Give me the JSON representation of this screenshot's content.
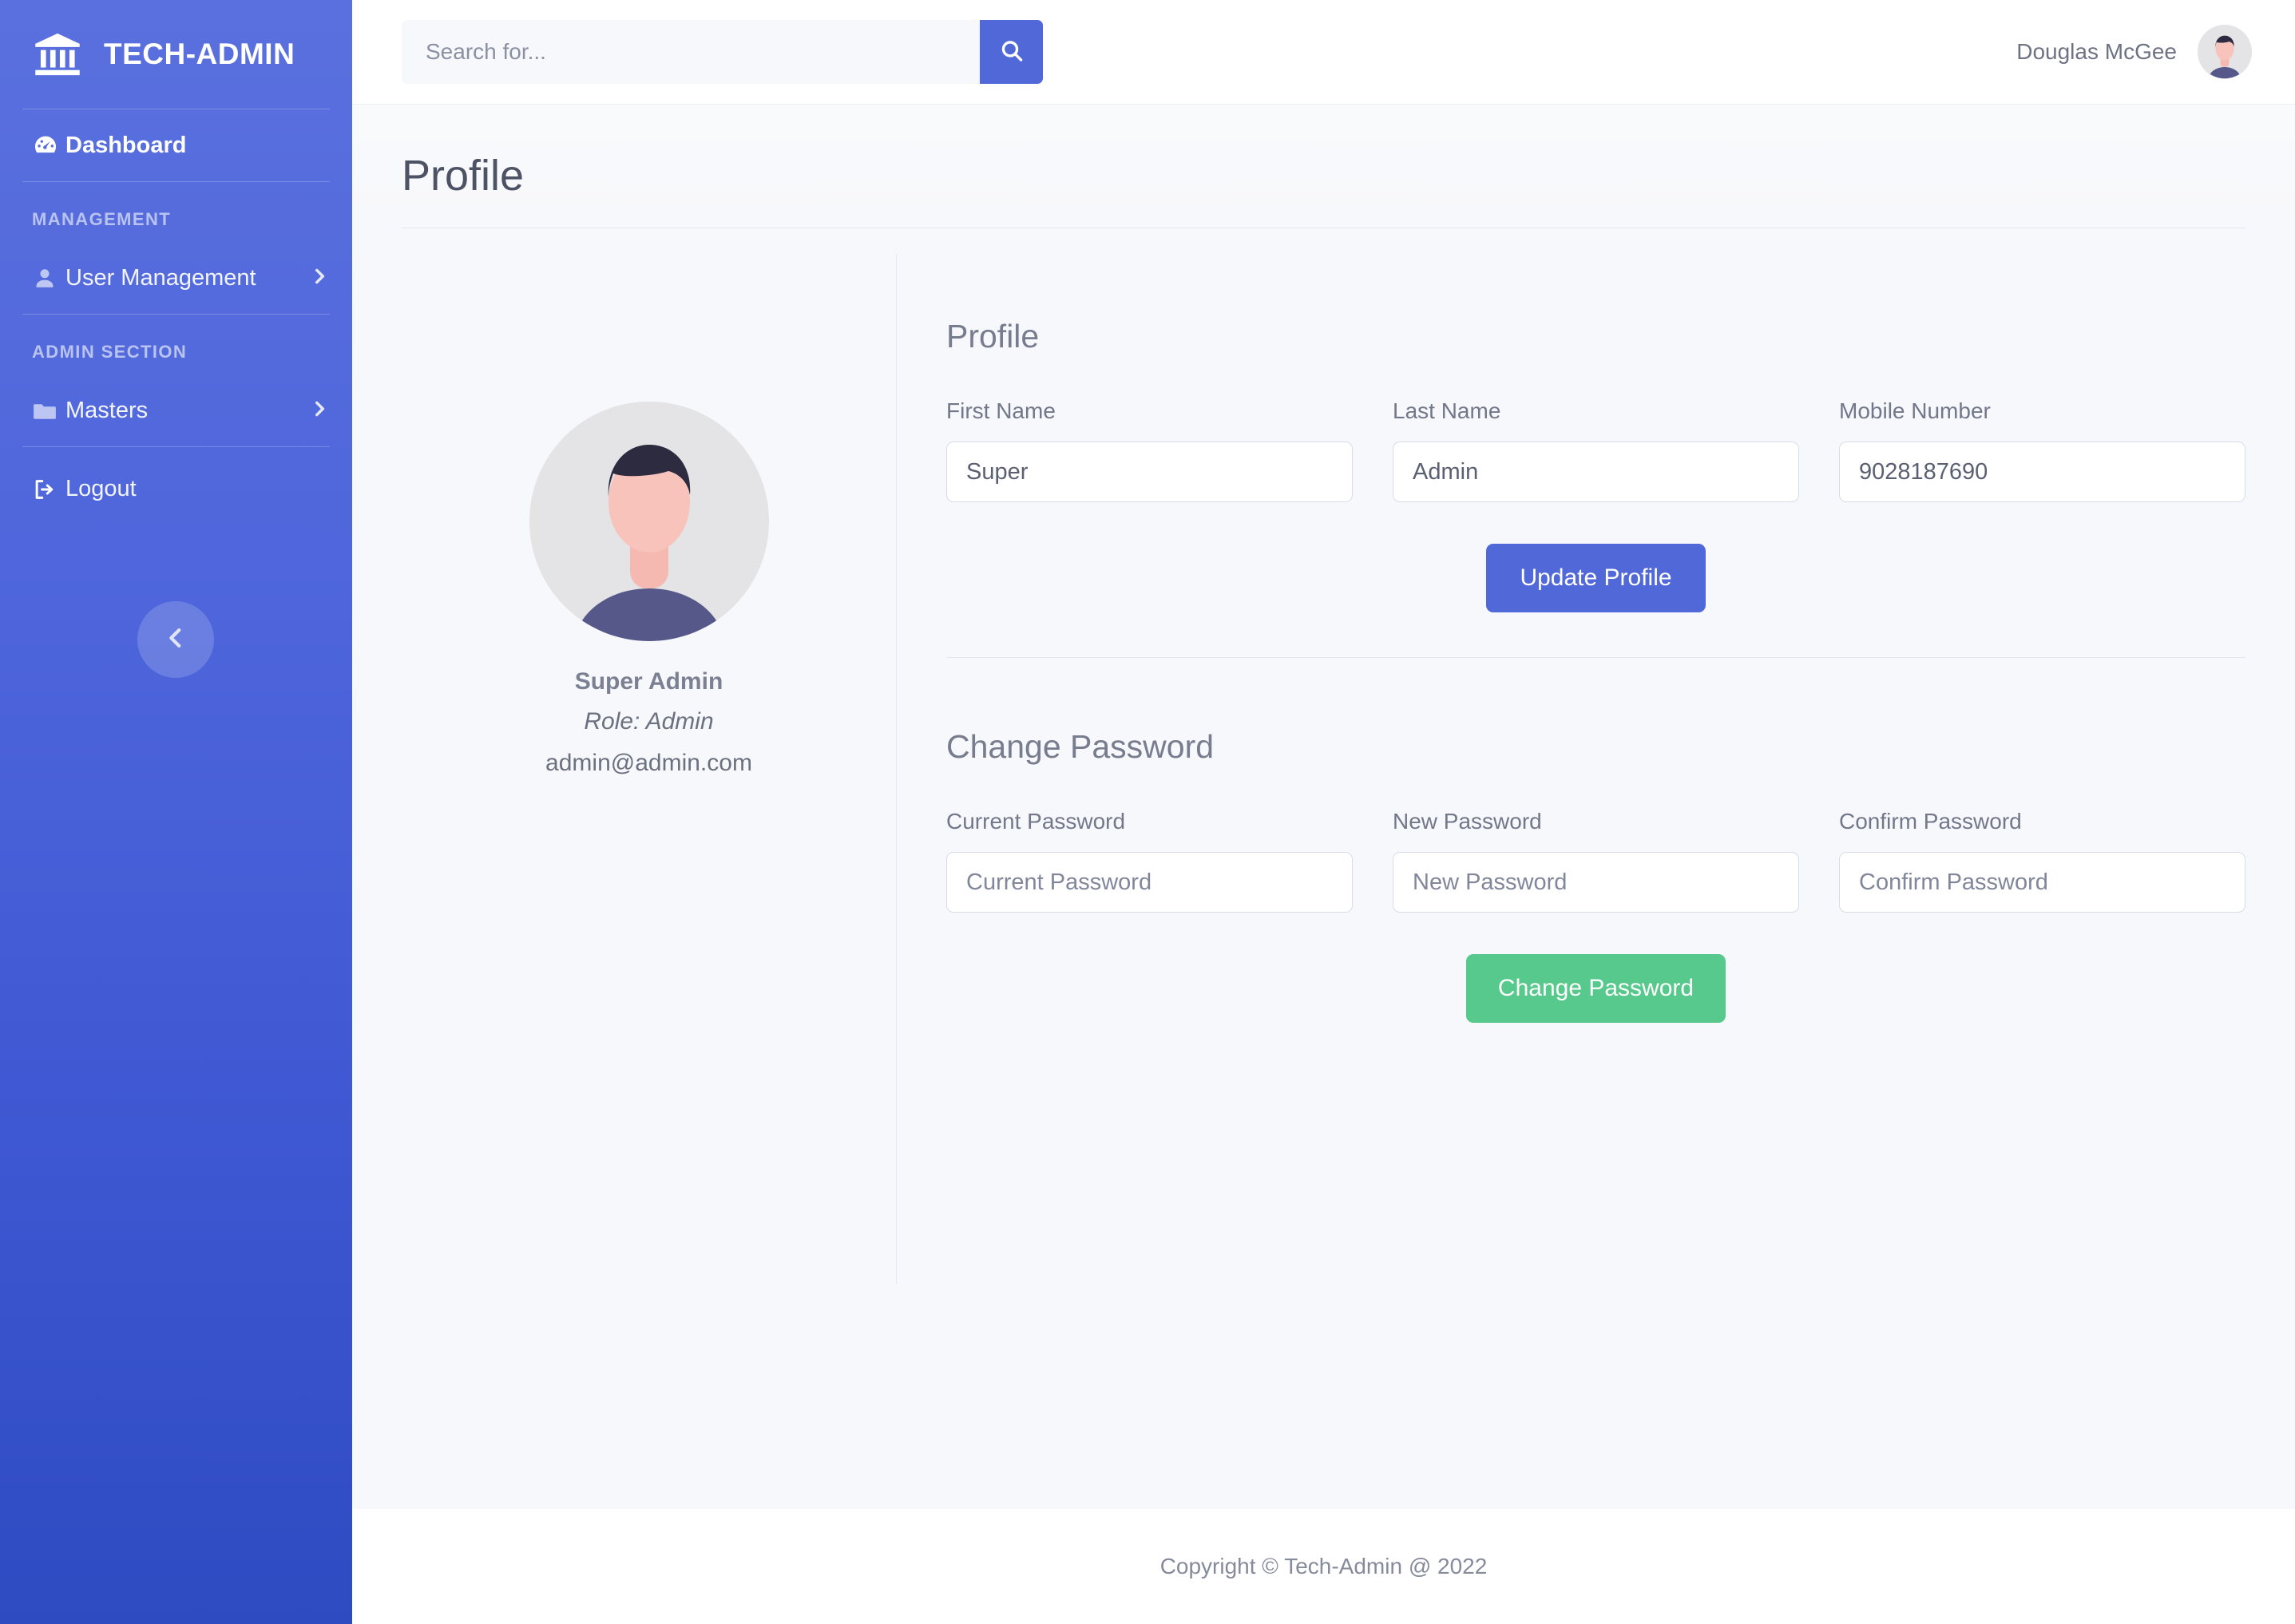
{
  "brand": {
    "name": "TECH-ADMIN",
    "icon": "bank-icon"
  },
  "sidebar": {
    "dashboard": {
      "label": "Dashboard",
      "icon": "tachometer-icon"
    },
    "groups": [
      {
        "label": "MANAGEMENT",
        "items": [
          {
            "label": "User Management",
            "icon": "user-icon",
            "chevron": "chevron-right-icon"
          }
        ]
      },
      {
        "label": "ADMIN SECTION",
        "items": [
          {
            "label": "Masters",
            "icon": "folder-icon",
            "chevron": "chevron-right-icon"
          }
        ]
      }
    ],
    "logout": {
      "label": "Logout",
      "icon": "logout-icon"
    },
    "collapse": {
      "icon": "chevron-left-icon"
    }
  },
  "topbar": {
    "search": {
      "value": "",
      "placeholder": "Search for...",
      "button_icon": "search-icon"
    },
    "user": {
      "name": "Douglas McGee",
      "avatar": "user-avatar"
    }
  },
  "page": {
    "title": "Profile"
  },
  "profile_card": {
    "avatar": "user-avatar",
    "name": "Super Admin",
    "role": "Role: Admin",
    "email": "admin@admin.com"
  },
  "profile_form": {
    "title": "Profile",
    "fields": [
      {
        "label": "First Name",
        "value": "Super",
        "placeholder": "First Name"
      },
      {
        "label": "Last Name",
        "value": "Admin",
        "placeholder": "Last Name"
      },
      {
        "label": "Mobile Number",
        "value": "9028187690",
        "placeholder": "Mobile Number"
      }
    ],
    "submit_label": "Update Profile"
  },
  "password_form": {
    "title": "Change Password",
    "fields": [
      {
        "label": "Current Password",
        "value": "",
        "placeholder": "Current Password"
      },
      {
        "label": "New Password",
        "value": "",
        "placeholder": "New Password"
      },
      {
        "label": "Confirm Password",
        "value": "",
        "placeholder": "Confirm Password"
      }
    ],
    "submit_label": "Change Password"
  },
  "footer": {
    "text": "Copyright © Tech-Admin @ 2022"
  },
  "colors": {
    "sidebar_top": "#5a70de",
    "sidebar_bottom": "#2e4bc2",
    "accent": "#5068d8",
    "success": "#57c98c",
    "page_bg": "#f7f8fb"
  }
}
